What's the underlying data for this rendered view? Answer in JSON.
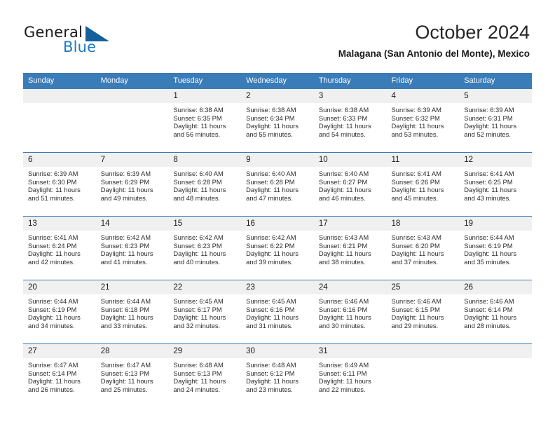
{
  "brand": {
    "name_part1": "General",
    "name_part2": "Blue",
    "triangle_color": "#15609c",
    "blue_color": "#1e7bc4"
  },
  "header": {
    "title": "October 2024",
    "subtitle": "Malagana (San Antonio del Monte), Mexico"
  },
  "theme": {
    "header_blue": "#3a7cb8",
    "daynum_band": "#f0f0f0",
    "text": "#2b2b2b"
  },
  "weekday_headers": [
    "Sunday",
    "Monday",
    "Tuesday",
    "Wednesday",
    "Thursday",
    "Friday",
    "Saturday"
  ],
  "weeks": [
    [
      {
        "day": "",
        "sunrise": "",
        "sunset": "",
        "daylight_line1": "",
        "daylight_line2": ""
      },
      {
        "day": "",
        "sunrise": "",
        "sunset": "",
        "daylight_line1": "",
        "daylight_line2": ""
      },
      {
        "day": "1",
        "sunrise": "Sunrise: 6:38 AM",
        "sunset": "Sunset: 6:35 PM",
        "daylight_line1": "Daylight: 11 hours",
        "daylight_line2": "and 56 minutes."
      },
      {
        "day": "2",
        "sunrise": "Sunrise: 6:38 AM",
        "sunset": "Sunset: 6:34 PM",
        "daylight_line1": "Daylight: 11 hours",
        "daylight_line2": "and 55 minutes."
      },
      {
        "day": "3",
        "sunrise": "Sunrise: 6:38 AM",
        "sunset": "Sunset: 6:33 PM",
        "daylight_line1": "Daylight: 11 hours",
        "daylight_line2": "and 54 minutes."
      },
      {
        "day": "4",
        "sunrise": "Sunrise: 6:39 AM",
        "sunset": "Sunset: 6:32 PM",
        "daylight_line1": "Daylight: 11 hours",
        "daylight_line2": "and 53 minutes."
      },
      {
        "day": "5",
        "sunrise": "Sunrise: 6:39 AM",
        "sunset": "Sunset: 6:31 PM",
        "daylight_line1": "Daylight: 11 hours",
        "daylight_line2": "and 52 minutes."
      }
    ],
    [
      {
        "day": "6",
        "sunrise": "Sunrise: 6:39 AM",
        "sunset": "Sunset: 6:30 PM",
        "daylight_line1": "Daylight: 11 hours",
        "daylight_line2": "and 51 minutes."
      },
      {
        "day": "7",
        "sunrise": "Sunrise: 6:39 AM",
        "sunset": "Sunset: 6:29 PM",
        "daylight_line1": "Daylight: 11 hours",
        "daylight_line2": "and 49 minutes."
      },
      {
        "day": "8",
        "sunrise": "Sunrise: 6:40 AM",
        "sunset": "Sunset: 6:28 PM",
        "daylight_line1": "Daylight: 11 hours",
        "daylight_line2": "and 48 minutes."
      },
      {
        "day": "9",
        "sunrise": "Sunrise: 6:40 AM",
        "sunset": "Sunset: 6:28 PM",
        "daylight_line1": "Daylight: 11 hours",
        "daylight_line2": "and 47 minutes."
      },
      {
        "day": "10",
        "sunrise": "Sunrise: 6:40 AM",
        "sunset": "Sunset: 6:27 PM",
        "daylight_line1": "Daylight: 11 hours",
        "daylight_line2": "and 46 minutes."
      },
      {
        "day": "11",
        "sunrise": "Sunrise: 6:41 AM",
        "sunset": "Sunset: 6:26 PM",
        "daylight_line1": "Daylight: 11 hours",
        "daylight_line2": "and 45 minutes."
      },
      {
        "day": "12",
        "sunrise": "Sunrise: 6:41 AM",
        "sunset": "Sunset: 6:25 PM",
        "daylight_line1": "Daylight: 11 hours",
        "daylight_line2": "and 43 minutes."
      }
    ],
    [
      {
        "day": "13",
        "sunrise": "Sunrise: 6:41 AM",
        "sunset": "Sunset: 6:24 PM",
        "daylight_line1": "Daylight: 11 hours",
        "daylight_line2": "and 42 minutes."
      },
      {
        "day": "14",
        "sunrise": "Sunrise: 6:42 AM",
        "sunset": "Sunset: 6:23 PM",
        "daylight_line1": "Daylight: 11 hours",
        "daylight_line2": "and 41 minutes."
      },
      {
        "day": "15",
        "sunrise": "Sunrise: 6:42 AM",
        "sunset": "Sunset: 6:23 PM",
        "daylight_line1": "Daylight: 11 hours",
        "daylight_line2": "and 40 minutes."
      },
      {
        "day": "16",
        "sunrise": "Sunrise: 6:42 AM",
        "sunset": "Sunset: 6:22 PM",
        "daylight_line1": "Daylight: 11 hours",
        "daylight_line2": "and 39 minutes."
      },
      {
        "day": "17",
        "sunrise": "Sunrise: 6:43 AM",
        "sunset": "Sunset: 6:21 PM",
        "daylight_line1": "Daylight: 11 hours",
        "daylight_line2": "and 38 minutes."
      },
      {
        "day": "18",
        "sunrise": "Sunrise: 6:43 AM",
        "sunset": "Sunset: 6:20 PM",
        "daylight_line1": "Daylight: 11 hours",
        "daylight_line2": "and 37 minutes."
      },
      {
        "day": "19",
        "sunrise": "Sunrise: 6:44 AM",
        "sunset": "Sunset: 6:19 PM",
        "daylight_line1": "Daylight: 11 hours",
        "daylight_line2": "and 35 minutes."
      }
    ],
    [
      {
        "day": "20",
        "sunrise": "Sunrise: 6:44 AM",
        "sunset": "Sunset: 6:19 PM",
        "daylight_line1": "Daylight: 11 hours",
        "daylight_line2": "and 34 minutes."
      },
      {
        "day": "21",
        "sunrise": "Sunrise: 6:44 AM",
        "sunset": "Sunset: 6:18 PM",
        "daylight_line1": "Daylight: 11 hours",
        "daylight_line2": "and 33 minutes."
      },
      {
        "day": "22",
        "sunrise": "Sunrise: 6:45 AM",
        "sunset": "Sunset: 6:17 PM",
        "daylight_line1": "Daylight: 11 hours",
        "daylight_line2": "and 32 minutes."
      },
      {
        "day": "23",
        "sunrise": "Sunrise: 6:45 AM",
        "sunset": "Sunset: 6:16 PM",
        "daylight_line1": "Daylight: 11 hours",
        "daylight_line2": "and 31 minutes."
      },
      {
        "day": "24",
        "sunrise": "Sunrise: 6:46 AM",
        "sunset": "Sunset: 6:16 PM",
        "daylight_line1": "Daylight: 11 hours",
        "daylight_line2": "and 30 minutes."
      },
      {
        "day": "25",
        "sunrise": "Sunrise: 6:46 AM",
        "sunset": "Sunset: 6:15 PM",
        "daylight_line1": "Daylight: 11 hours",
        "daylight_line2": "and 29 minutes."
      },
      {
        "day": "26",
        "sunrise": "Sunrise: 6:46 AM",
        "sunset": "Sunset: 6:14 PM",
        "daylight_line1": "Daylight: 11 hours",
        "daylight_line2": "and 28 minutes."
      }
    ],
    [
      {
        "day": "27",
        "sunrise": "Sunrise: 6:47 AM",
        "sunset": "Sunset: 6:14 PM",
        "daylight_line1": "Daylight: 11 hours",
        "daylight_line2": "and 26 minutes."
      },
      {
        "day": "28",
        "sunrise": "Sunrise: 6:47 AM",
        "sunset": "Sunset: 6:13 PM",
        "daylight_line1": "Daylight: 11 hours",
        "daylight_line2": "and 25 minutes."
      },
      {
        "day": "29",
        "sunrise": "Sunrise: 6:48 AM",
        "sunset": "Sunset: 6:13 PM",
        "daylight_line1": "Daylight: 11 hours",
        "daylight_line2": "and 24 minutes."
      },
      {
        "day": "30",
        "sunrise": "Sunrise: 6:48 AM",
        "sunset": "Sunset: 6:12 PM",
        "daylight_line1": "Daylight: 11 hours",
        "daylight_line2": "and 23 minutes."
      },
      {
        "day": "31",
        "sunrise": "Sunrise: 6:49 AM",
        "sunset": "Sunset: 6:11 PM",
        "daylight_line1": "Daylight: 11 hours",
        "daylight_line2": "and 22 minutes."
      },
      {
        "day": "",
        "sunrise": "",
        "sunset": "",
        "daylight_line1": "",
        "daylight_line2": ""
      },
      {
        "day": "",
        "sunrise": "",
        "sunset": "",
        "daylight_line1": "",
        "daylight_line2": ""
      }
    ]
  ]
}
